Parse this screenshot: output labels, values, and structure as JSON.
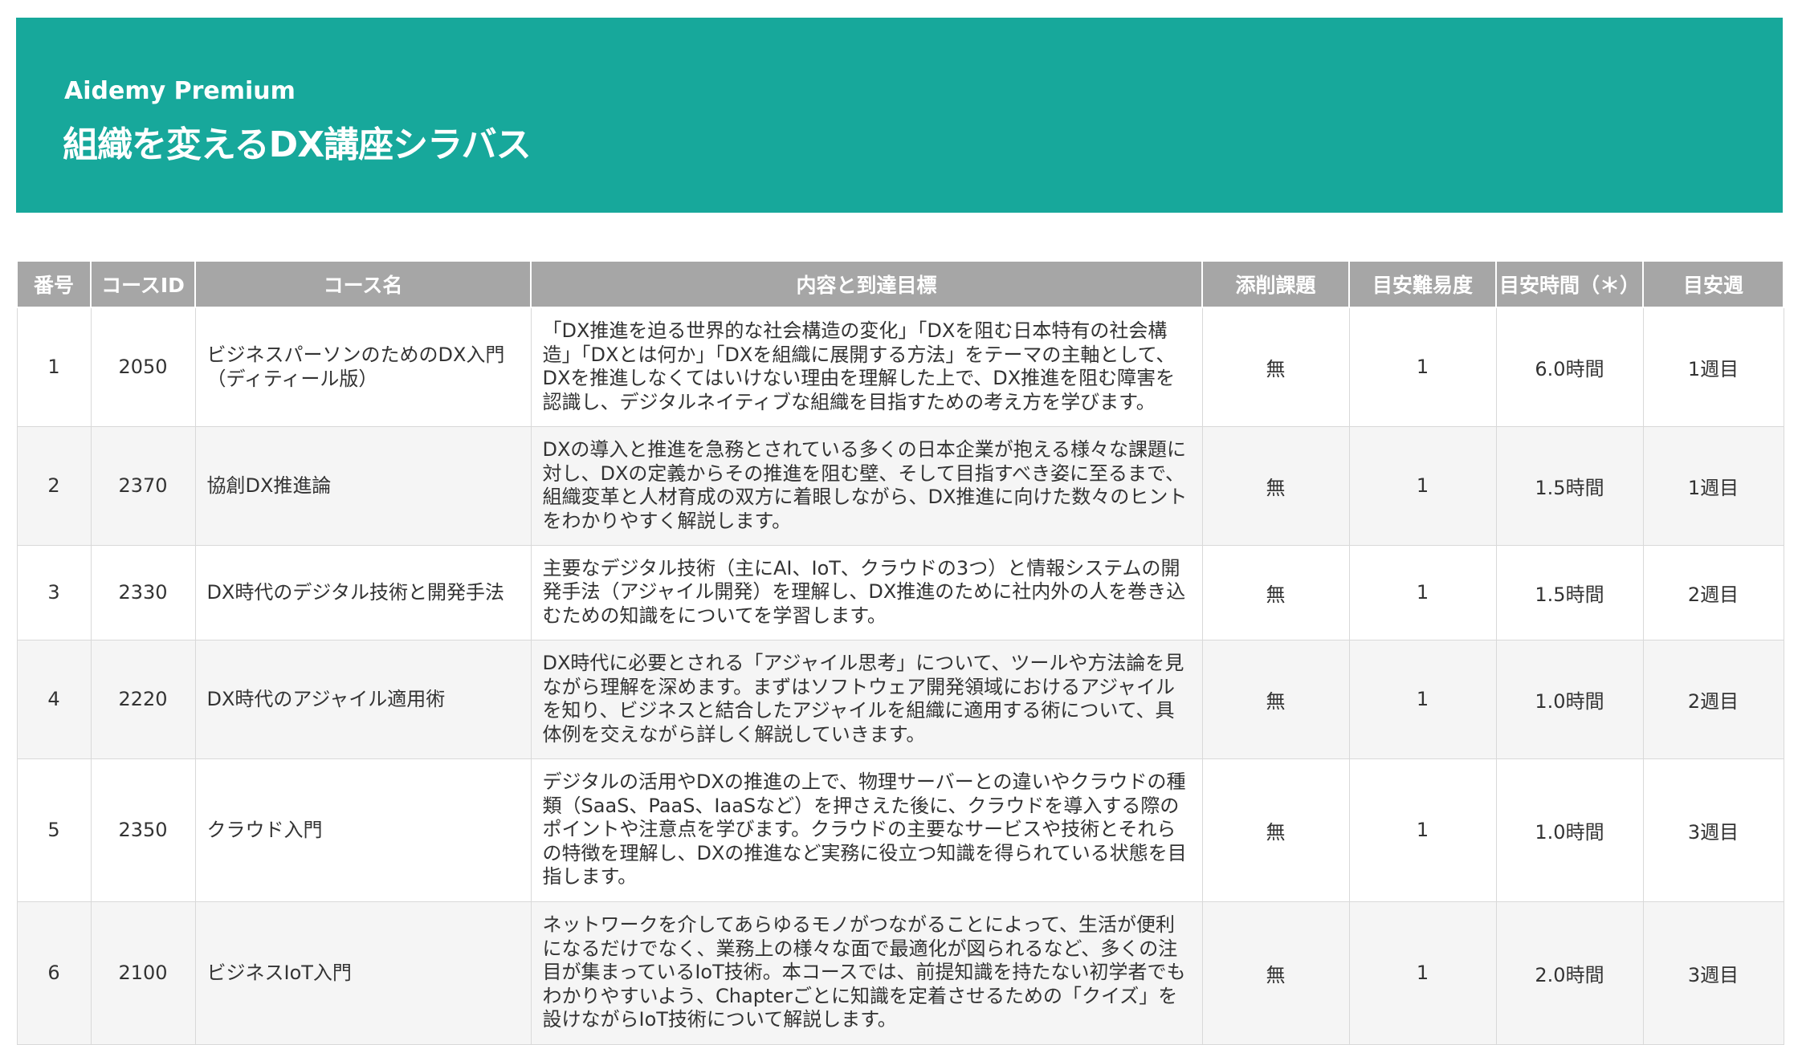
{
  "header": {
    "brand": "Aidemy Premium",
    "title": "組織を変えるDX講座シラバス"
  },
  "table": {
    "columns": [
      "番号",
      "コースID",
      "コース名",
      "内容と到達目標",
      "添削課題",
      "目安難易度",
      "目安時間（＊）",
      "目安週"
    ],
    "rows": [
      {
        "no": "1",
        "id": "2050",
        "name": "ビジネスパーソンのためのDX入門（ディティール版）",
        "desc": "「DX推進を迫る世界的な社会構造の変化」「DXを阻む日本特有の社会構造」「DXとは何か」「DXを組織に展開する方法」をテーマの主軸として、DXを推進しなくてはいけない理由を理解した上で、DX推進を阻む障害を認識し、デジタルネイティブな組織を目指すための考え方を学びます。",
        "assignment": "無",
        "difficulty": "1",
        "hours": "6.0時間",
        "week": "1週目"
      },
      {
        "no": "2",
        "id": "2370",
        "name": "協創DX推進論",
        "desc": "DXの導入と推進を急務とされている多くの日本企業が抱える様々な課題に対し、DXの定義からその推進を阻む壁、そして目指すべき姿に至るまで、組織変革と人材育成の双方に着眼しながら、DX推進に向けた数々のヒントをわかりやすく解説します。",
        "assignment": "無",
        "difficulty": "1",
        "hours": "1.5時間",
        "week": "1週目"
      },
      {
        "no": "3",
        "id": "2330",
        "name": "DX時代のデジタル技術と開発手法",
        "desc": "主要なデジタル技術（主にAI、IoT、クラウドの3つ）と情報システムの開発手法（アジャイル開発）を理解し、DX推進のために社内外の人を巻き込むための知識をについてを学習します。",
        "assignment": "無",
        "difficulty": "1",
        "hours": "1.5時間",
        "week": "2週目"
      },
      {
        "no": "4",
        "id": "2220",
        "name": "DX時代のアジャイル適用術",
        "desc": "DX時代に必要とされる「アジャイル思考」について、ツールや方法論を見ながら理解を深めます。まずはソフトウェア開発領域におけるアジャイルを知り、ビジネスと結合したアジャイルを組織に適用する術について、具体例を交えながら詳しく解説していきます。",
        "assignment": "無",
        "difficulty": "1",
        "hours": "1.0時間",
        "week": "2週目"
      },
      {
        "no": "5",
        "id": "2350",
        "name": "クラウド入門",
        "desc": "デジタルの活用やDXの推進の上で、物理サーバーとの違いやクラウドの種類（SaaS、PaaS、IaaSなど）を押さえた後に、クラウドを導入する際のポイントや注意点を学びます。クラウドの主要なサービスや技術とそれらの特徴を理解し、DXの推進など実務に役立つ知識を得られている状態を目指します。",
        "assignment": "無",
        "difficulty": "1",
        "hours": "1.0時間",
        "week": "3週目"
      },
      {
        "no": "6",
        "id": "2100",
        "name": "ビジネスIoT入門",
        "desc": "ネットワークを介してあらゆるモノがつながることによって、生活が便利になるだけでなく、業務上の様々な面で最適化が図られるなど、多くの注目が集まっているIoT技術。本コースでは、前提知識を持たない初学者でもわかりやすいよう、Chapterごとに知識を定着させるための「クイズ」を設けながらIoT技術について解説します。",
        "assignment": "無",
        "difficulty": "1",
        "hours": "2.0時間",
        "week": "3週目"
      }
    ]
  }
}
